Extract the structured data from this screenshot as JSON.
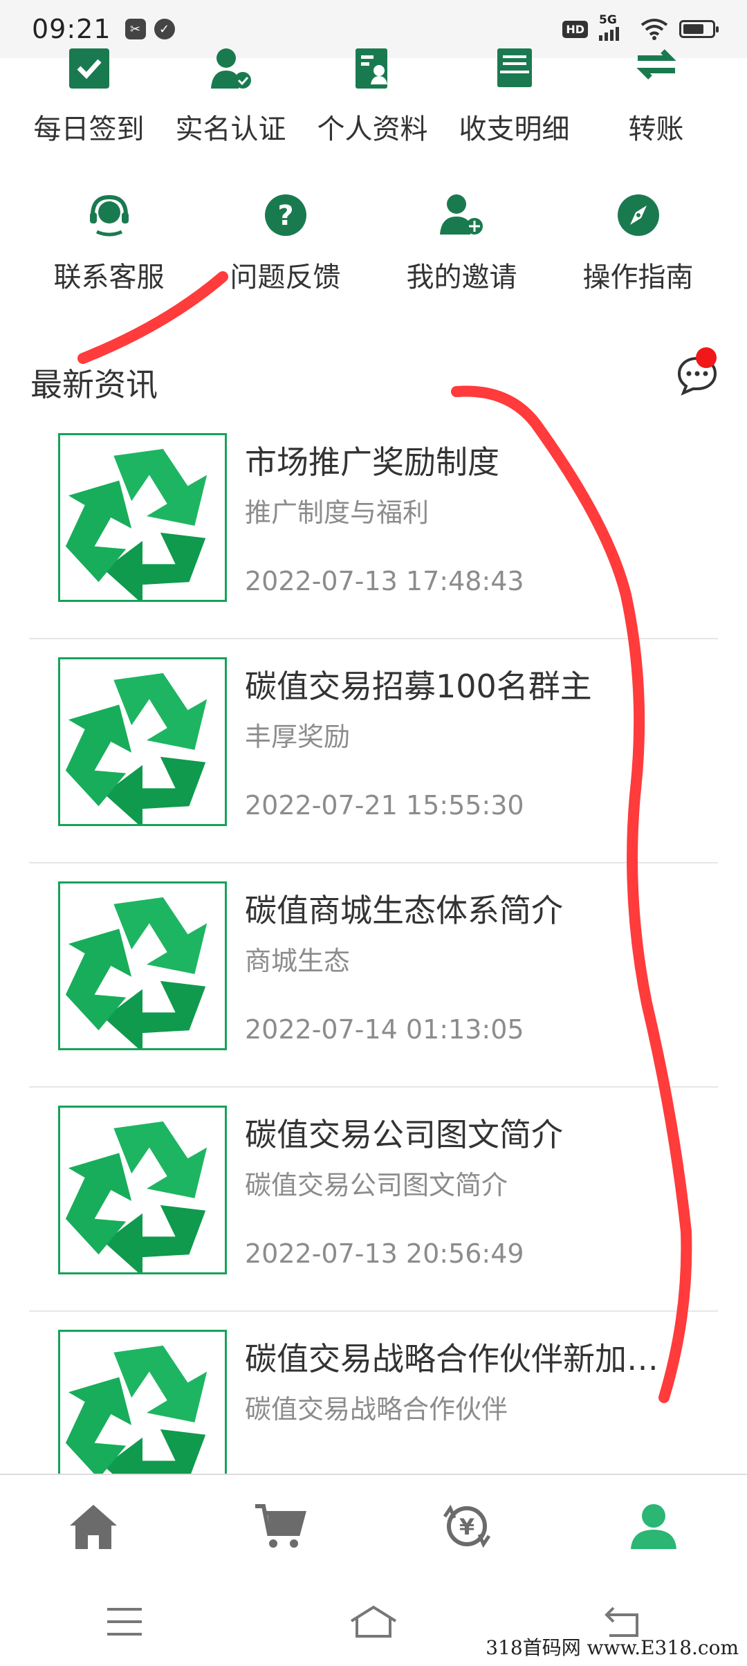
{
  "status_bar": {
    "time": "09:21",
    "badge_hd": "HD",
    "network": "5G"
  },
  "menu_row1": [
    {
      "label": "每日签到",
      "icon": "calendar-check-icon"
    },
    {
      "label": "实名认证",
      "icon": "user-verified-icon"
    },
    {
      "label": "个人资料",
      "icon": "profile-card-icon"
    },
    {
      "label": "收支明细",
      "icon": "ledger-tray-icon"
    },
    {
      "label": "转账",
      "icon": "transfer-arrows-icon"
    }
  ],
  "menu_row2": [
    {
      "label": "联系客服",
      "icon": "headset-icon"
    },
    {
      "label": "问题反馈",
      "icon": "question-circle-icon"
    },
    {
      "label": "我的邀请",
      "icon": "user-add-icon"
    },
    {
      "label": "操作指南",
      "icon": "compass-icon"
    }
  ],
  "section": {
    "title": "最新资讯"
  },
  "news": [
    {
      "title": "市场推广奖励制度",
      "subtitle": "推广制度与福利",
      "date": "2022-07-13 17:48:43"
    },
    {
      "title": "碳值交易招募100名群主",
      "subtitle": "丰厚奖励",
      "date": "2022-07-21 15:55:30"
    },
    {
      "title": "碳值商城生态体系简介",
      "subtitle": "商城生态",
      "date": "2022-07-14 01:13:05"
    },
    {
      "title": "碳值交易公司图文简介",
      "subtitle": "碳值交易公司图文简介",
      "date": "2022-07-13 20:56:49"
    },
    {
      "title": "碳值交易战略合作伙伴新加…",
      "subtitle": "碳值交易战略合作伙伴",
      "date": ""
    }
  ],
  "tabbar": [
    "home-icon",
    "cart-icon",
    "exchange-yen-icon",
    "user-icon"
  ],
  "colors": {
    "accent": "#1a7a4f",
    "active_tab": "#2bb673",
    "badge": "#f01818",
    "annotation": "#ff3b3b"
  },
  "watermark": "318首码网 www.E318.com"
}
